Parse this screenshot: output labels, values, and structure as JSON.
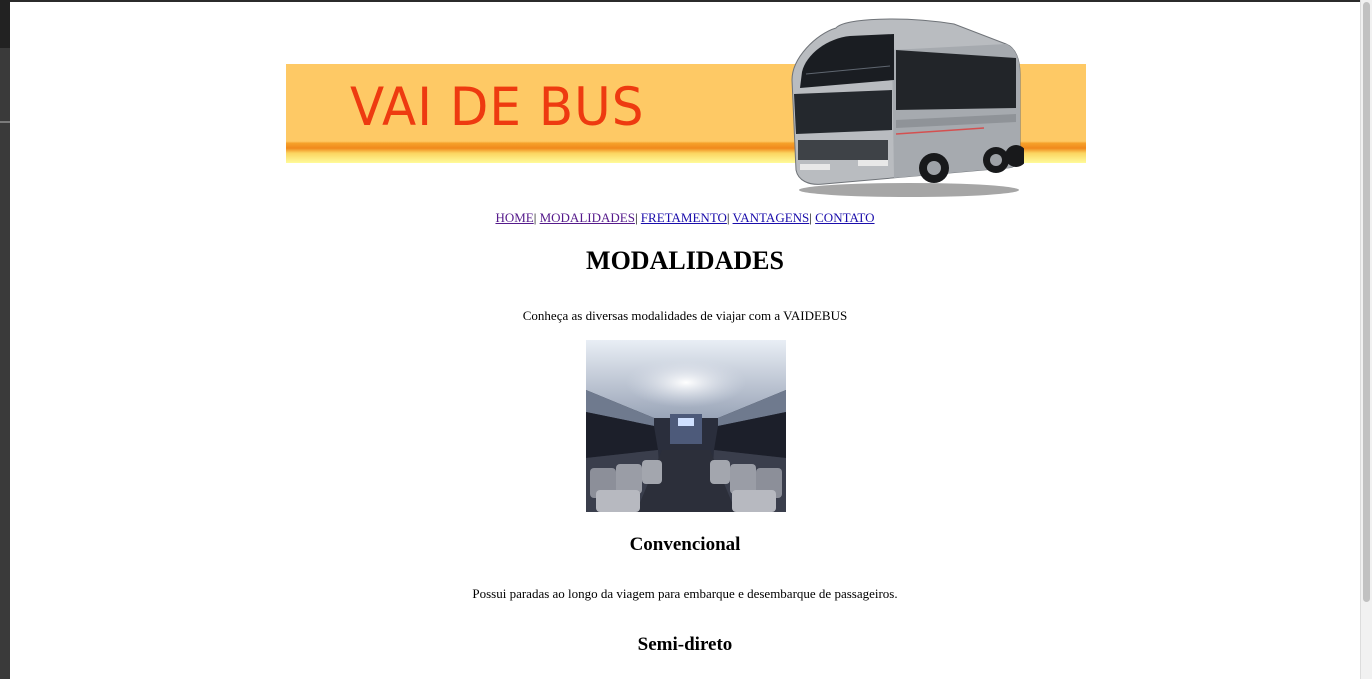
{
  "banner": {
    "title": "VAI DE BUS",
    "colors": {
      "band": "#fec965",
      "title": "#ee3a10",
      "stripe": "#f0891c"
    }
  },
  "nav": {
    "items": [
      {
        "label": "HOME",
        "sep": "| "
      },
      {
        "label": "MODALIDADES",
        "sep": "| "
      },
      {
        "label": "FRETAMENTO",
        "sep": "| "
      },
      {
        "label": "VANTAGENS",
        "sep": "| "
      },
      {
        "label": "CONTATO",
        "sep": ""
      }
    ]
  },
  "main": {
    "title": "MODALIDADES",
    "intro": "Conheça as diversas modalidades de viajar com a VAIDEBUS",
    "sections": [
      {
        "title": "Convencional",
        "description": "Possui paradas ao longo da viagem para embarque e desembarque de passageiros."
      },
      {
        "title": "Semi-direto"
      }
    ]
  }
}
